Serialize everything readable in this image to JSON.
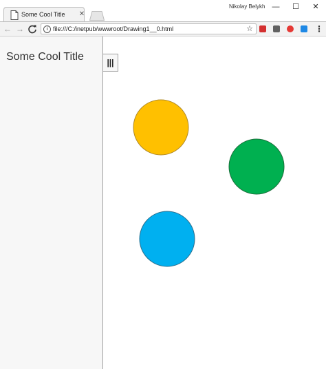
{
  "tab": {
    "title": "Some Cool Title",
    "close_glyph": "✕",
    "page_icon": "page-icon"
  },
  "profile": {
    "name": "Nikolay Belykh"
  },
  "window_controls": {
    "minimize": "—",
    "maximize": "☐",
    "close": "✕"
  },
  "toolbar": {
    "back_glyph": "←",
    "forward_glyph": "→",
    "reload_glyph": "C",
    "url": "file:///C:/inetpub/wwwroot/Drawing1__0.html",
    "info_glyph": "i",
    "star_glyph": "☆",
    "menu_glyph": "⋮",
    "extensions": [
      {
        "name": "red-bookmark-extension-icon",
        "color": "#d32f2f"
      },
      {
        "name": "mail-extension-icon",
        "color": "#616161"
      },
      {
        "name": "opera-extension-icon",
        "color": "#e53935"
      },
      {
        "name": "blue-extension-icon",
        "color": "#1e88e5"
      }
    ]
  },
  "sidebar": {
    "title": "Some Cool Title",
    "toggle_glyph": "|||"
  },
  "drawing": {
    "circles": [
      {
        "name": "yellow-circle",
        "fill": "#ffc000",
        "stroke": "#b08a2a"
      },
      {
        "name": "green-circle",
        "fill": "#00b050",
        "stroke": "#1b6e3a"
      },
      {
        "name": "blue-circle",
        "fill": "#00b0f0",
        "stroke": "#2a6f8e"
      }
    ]
  }
}
